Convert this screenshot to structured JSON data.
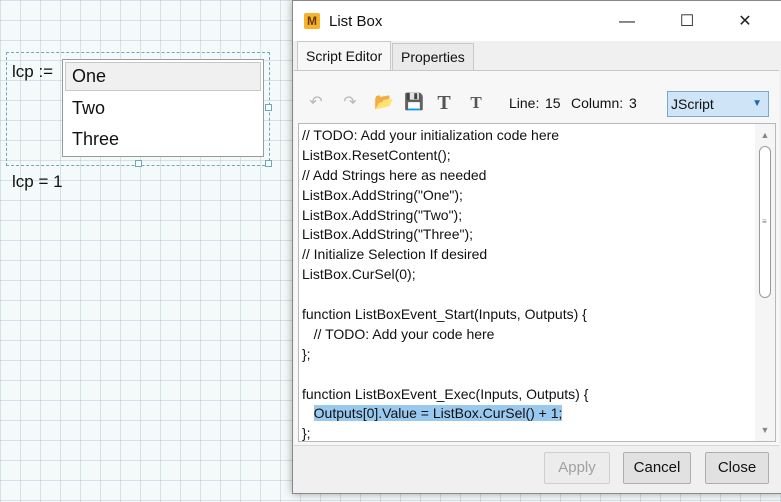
{
  "worksheet": {
    "variable_label": "lcp :=",
    "listbox_items": [
      "One",
      "Two",
      "Three"
    ],
    "selected_index": 0,
    "result_text": "lcp = 1"
  },
  "dialog": {
    "app_icon_letter": "M",
    "title": "List Box",
    "window_controls": {
      "minimize": "—",
      "maximize": "☐",
      "close": "✕"
    },
    "tabs": [
      {
        "label": "Script Editor",
        "active": true
      },
      {
        "label": "Properties",
        "active": false
      }
    ],
    "toolbar": {
      "icons": [
        "undo-icon",
        "redo-icon",
        "open-folder-icon",
        "save-icon",
        "font-icon",
        "font-size-icon"
      ],
      "line_label": "Line:",
      "line_value": "15",
      "column_label": "Column:",
      "column_value": "3",
      "language": "JScript"
    },
    "code_lines": [
      "// TODO: Add your initialization code here",
      "ListBox.ResetContent();",
      "// Add Strings here as needed",
      "ListBox.AddString(\"One\");",
      "ListBox.AddString(\"Two\");",
      "ListBox.AddString(\"Three\");",
      "// Initialize Selection If desired",
      "ListBox.CurSel(0);",
      "",
      "function ListBoxEvent_Start(Inputs, Outputs) {",
      "   // TODO: Add your code here",
      "};",
      "",
      "function ListBoxEvent_Exec(Inputs, Outputs) {",
      "   Outputs[0].Value = ListBox.CurSel() + 1;",
      "};"
    ],
    "highlighted_line": 14,
    "buttons": {
      "apply": "Apply",
      "cancel": "Cancel",
      "close": "Close"
    },
    "colors": {
      "selection_highlight": "#99c9ef",
      "language_select_bg": "#cfe4f6",
      "app_icon": "#f7b32b"
    }
  }
}
